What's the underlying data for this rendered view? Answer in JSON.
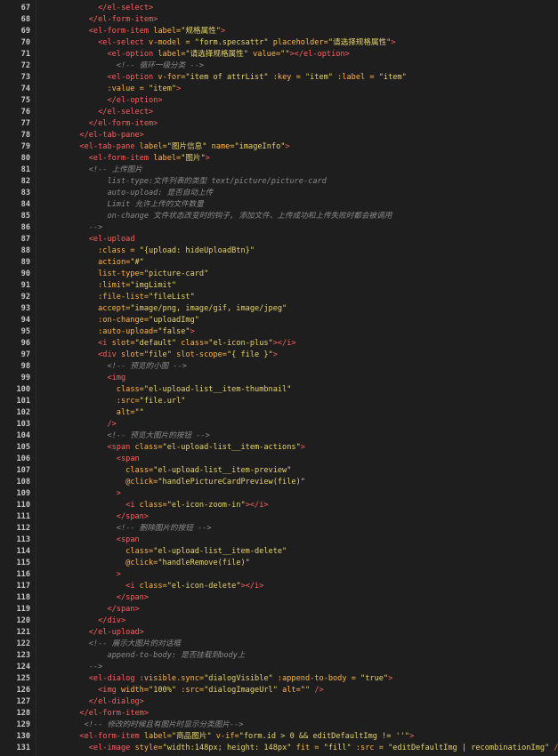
{
  "editor": {
    "lines": [
      {
        "n": "67",
        "t": [
          [
            "            ",
            "pun"
          ],
          [
            "</el-select>",
            "tag"
          ]
        ]
      },
      {
        "n": "68",
        "t": [
          [
            "          ",
            "pun"
          ],
          [
            "</el-form-item>",
            "tag"
          ]
        ]
      },
      {
        "n": "69",
        "t": [
          [
            "          ",
            "pun"
          ],
          [
            "<el-form-item ",
            "tag"
          ],
          [
            "label=",
            "att"
          ],
          [
            "\"规格属性\"",
            "str"
          ],
          [
            ">",
            "tag"
          ]
        ]
      },
      {
        "n": "70",
        "t": [
          [
            "            ",
            "pun"
          ],
          [
            "<el-select ",
            "tag"
          ],
          [
            "v-model = ",
            "att"
          ],
          [
            "\"form.specsattr\" ",
            "str"
          ],
          [
            "placeholder=",
            "att"
          ],
          [
            "\"请选择规格属性\"",
            "str"
          ],
          [
            ">",
            "tag"
          ]
        ]
      },
      {
        "n": "71",
        "t": [
          [
            "              ",
            "pun"
          ],
          [
            "<el-option ",
            "tag"
          ],
          [
            "label=",
            "att"
          ],
          [
            "\"请选择规格属性\" ",
            "str"
          ],
          [
            "value=",
            "att"
          ],
          [
            "\"\"",
            "str"
          ],
          [
            "></el-option>",
            "tag"
          ]
        ]
      },
      {
        "n": "72",
        "t": [
          [
            "                ",
            "pun"
          ],
          [
            "<!-- 循环一级分类 -->",
            "com"
          ]
        ]
      },
      {
        "n": "73",
        "t": [
          [
            "              ",
            "pun"
          ],
          [
            "<el-option ",
            "tag"
          ],
          [
            "v-for=",
            "att"
          ],
          [
            "\"item of attrList\" ",
            "str"
          ],
          [
            ":key = ",
            "att"
          ],
          [
            "\"item\" ",
            "str"
          ],
          [
            ":label = ",
            "att"
          ],
          [
            "\"item\"",
            "str"
          ]
        ]
      },
      {
        "n": "74",
        "t": [
          [
            "              ",
            "pun"
          ],
          [
            ":value = ",
            "att"
          ],
          [
            "\"item\"",
            "str"
          ],
          [
            ">",
            "tag"
          ]
        ]
      },
      {
        "n": "75",
        "t": [
          [
            "              ",
            "pun"
          ],
          [
            "</el-option>",
            "tag"
          ]
        ]
      },
      {
        "n": "76",
        "t": [
          [
            "            ",
            "pun"
          ],
          [
            "</el-select>",
            "tag"
          ]
        ]
      },
      {
        "n": "77",
        "t": [
          [
            "          ",
            "pun"
          ],
          [
            "</el-form-item>",
            "tag"
          ]
        ]
      },
      {
        "n": "78",
        "t": [
          [
            "        ",
            "pun"
          ],
          [
            "</el-tab-pane>",
            "tag"
          ]
        ]
      },
      {
        "n": "79",
        "t": [
          [
            "        ",
            "pun"
          ],
          [
            "<el-tab-pane ",
            "tag"
          ],
          [
            "label=",
            "att"
          ],
          [
            "\"图片信息\" ",
            "str"
          ],
          [
            "name=",
            "att"
          ],
          [
            "\"imageInfo\"",
            "str"
          ],
          [
            ">",
            "tag"
          ]
        ]
      },
      {
        "n": "80",
        "t": [
          [
            "          ",
            "pun"
          ],
          [
            "<el-form-item ",
            "tag"
          ],
          [
            "label=",
            "att"
          ],
          [
            "\"图片\"",
            "str"
          ],
          [
            ">",
            "tag"
          ]
        ]
      },
      {
        "n": "81",
        "t": [
          [
            "          ",
            "pun"
          ],
          [
            "<!-- 上传图片",
            "com"
          ]
        ]
      },
      {
        "n": "82",
        "t": [
          [
            "              ",
            "pun"
          ],
          [
            "list-type:文件列表的类型 text/picture/picture-card",
            "com"
          ]
        ]
      },
      {
        "n": "83",
        "t": [
          [
            "              ",
            "pun"
          ],
          [
            "auto-upload: 是否自动上传",
            "com"
          ]
        ]
      },
      {
        "n": "84",
        "t": [
          [
            "              ",
            "pun"
          ],
          [
            "Limit 允许上传的文件数量",
            "com"
          ]
        ]
      },
      {
        "n": "85",
        "t": [
          [
            "              ",
            "pun"
          ],
          [
            "on-change 文件状态改变时的钩子, 添加文件、上传成功和上传失败时都会被调用",
            "com"
          ]
        ]
      },
      {
        "n": "86",
        "t": [
          [
            "          ",
            "pun"
          ],
          [
            "-->",
            "com"
          ]
        ]
      },
      {
        "n": "87",
        "t": [
          [
            "          ",
            "pun"
          ],
          [
            "<el-upload",
            "tag"
          ]
        ]
      },
      {
        "n": "88",
        "t": [
          [
            "            ",
            "pun"
          ],
          [
            ":class = ",
            "att"
          ],
          [
            "\"{upload: hideUploadBtn}\"",
            "str"
          ]
        ]
      },
      {
        "n": "89",
        "t": [
          [
            "            ",
            "pun"
          ],
          [
            "action=",
            "att"
          ],
          [
            "\"#\"",
            "str"
          ]
        ]
      },
      {
        "n": "90",
        "t": [
          [
            "            ",
            "pun"
          ],
          [
            "list-type=",
            "att"
          ],
          [
            "\"picture-card\"",
            "str"
          ]
        ]
      },
      {
        "n": "91",
        "t": [
          [
            "            ",
            "pun"
          ],
          [
            ":limit=",
            "att"
          ],
          [
            "\"imgLimit\"",
            "str"
          ]
        ]
      },
      {
        "n": "92",
        "t": [
          [
            "            ",
            "pun"
          ],
          [
            ":file-list=",
            "att"
          ],
          [
            "\"fileList\"",
            "str"
          ]
        ]
      },
      {
        "n": "93",
        "t": [
          [
            "            ",
            "pun"
          ],
          [
            "accept=",
            "att"
          ],
          [
            "\"image/png, image/gif, image/jpeg\"",
            "str"
          ]
        ]
      },
      {
        "n": "94",
        "t": [
          [
            "            ",
            "pun"
          ],
          [
            ":on-change=",
            "att"
          ],
          [
            "\"uploadImg\"",
            "str"
          ]
        ]
      },
      {
        "n": "95",
        "t": [
          [
            "            ",
            "pun"
          ],
          [
            ":auto-upload=",
            "att"
          ],
          [
            "\"false\"",
            "str"
          ],
          [
            ">",
            "tag"
          ]
        ]
      },
      {
        "n": "96",
        "t": [
          [
            "            ",
            "pun"
          ],
          [
            "<i ",
            "tag"
          ],
          [
            "slot=",
            "att"
          ],
          [
            "\"default\" ",
            "str"
          ],
          [
            "class=",
            "att"
          ],
          [
            "\"el-icon-plus\"",
            "str"
          ],
          [
            "></i>",
            "tag"
          ]
        ]
      },
      {
        "n": "97",
        "t": [
          [
            "            ",
            "pun"
          ],
          [
            "<div ",
            "tag"
          ],
          [
            "slot=",
            "att"
          ],
          [
            "\"file\" ",
            "str"
          ],
          [
            "slot-scope=",
            "att"
          ],
          [
            "\"{ file }\"",
            "str"
          ],
          [
            ">",
            "tag"
          ]
        ]
      },
      {
        "n": "98",
        "t": [
          [
            "              ",
            "pun"
          ],
          [
            "<!-- 预览的小图 -->",
            "com"
          ]
        ]
      },
      {
        "n": "99",
        "t": [
          [
            "              ",
            "pun"
          ],
          [
            "<img",
            "tag"
          ]
        ]
      },
      {
        "n": "100",
        "t": [
          [
            "                ",
            "pun"
          ],
          [
            "class=",
            "att"
          ],
          [
            "\"el-upload-list__item-thumbnail\"",
            "str"
          ]
        ]
      },
      {
        "n": "101",
        "t": [
          [
            "                ",
            "pun"
          ],
          [
            ":src=",
            "att"
          ],
          [
            "\"file.url\"",
            "str"
          ]
        ]
      },
      {
        "n": "102",
        "t": [
          [
            "                ",
            "pun"
          ],
          [
            "alt=",
            "att"
          ],
          [
            "\"\"",
            "str"
          ]
        ]
      },
      {
        "n": "103",
        "t": [
          [
            "              ",
            "pun"
          ],
          [
            "/>",
            "tag"
          ]
        ]
      },
      {
        "n": "104",
        "t": [
          [
            "              ",
            "pun"
          ],
          [
            "<!-- 预览大图片的按钮 -->",
            "com"
          ]
        ]
      },
      {
        "n": "105",
        "t": [
          [
            "              ",
            "pun"
          ],
          [
            "<span ",
            "tag"
          ],
          [
            "class=",
            "att"
          ],
          [
            "\"el-upload-list__item-actions\"",
            "str"
          ],
          [
            ">",
            "tag"
          ]
        ]
      },
      {
        "n": "106",
        "t": [
          [
            "                ",
            "pun"
          ],
          [
            "<span",
            "tag"
          ]
        ]
      },
      {
        "n": "107",
        "t": [
          [
            "                  ",
            "pun"
          ],
          [
            "class=",
            "att"
          ],
          [
            "\"el-upload-list__item-preview\"",
            "str"
          ]
        ]
      },
      {
        "n": "108",
        "t": [
          [
            "                  ",
            "pun"
          ],
          [
            "@click=",
            "att"
          ],
          [
            "\"handlePictureCardPreview(file)\"",
            "str"
          ]
        ]
      },
      {
        "n": "109",
        "t": [
          [
            "                ",
            "pun"
          ],
          [
            ">",
            "tag"
          ]
        ]
      },
      {
        "n": "110",
        "t": [
          [
            "                  ",
            "pun"
          ],
          [
            "<i ",
            "tag"
          ],
          [
            "class=",
            "att"
          ],
          [
            "\"el-icon-zoom-in\"",
            "str"
          ],
          [
            "></i>",
            "tag"
          ]
        ]
      },
      {
        "n": "111",
        "t": [
          [
            "                ",
            "pun"
          ],
          [
            "</span>",
            "tag"
          ]
        ]
      },
      {
        "n": "112",
        "t": [
          [
            "                ",
            "pun"
          ],
          [
            "<!-- 删除图片的按钮 -->",
            "com"
          ]
        ]
      },
      {
        "n": "113",
        "t": [
          [
            "                ",
            "pun"
          ],
          [
            "<span",
            "tag"
          ]
        ]
      },
      {
        "n": "114",
        "t": [
          [
            "                  ",
            "pun"
          ],
          [
            "class=",
            "att"
          ],
          [
            "\"el-upload-list__item-delete\"",
            "str"
          ]
        ]
      },
      {
        "n": "115",
        "t": [
          [
            "                  ",
            "pun"
          ],
          [
            "@click=",
            "att"
          ],
          [
            "\"handleRemove(file)\"",
            "str"
          ]
        ]
      },
      {
        "n": "116",
        "t": [
          [
            "                ",
            "pun"
          ],
          [
            ">",
            "tag"
          ]
        ]
      },
      {
        "n": "117",
        "t": [
          [
            "                  ",
            "pun"
          ],
          [
            "<i ",
            "tag"
          ],
          [
            "class=",
            "att"
          ],
          [
            "\"el-icon-delete\"",
            "str"
          ],
          [
            "></i>",
            "tag"
          ]
        ]
      },
      {
        "n": "118",
        "t": [
          [
            "                ",
            "pun"
          ],
          [
            "</span>",
            "tag"
          ]
        ]
      },
      {
        "n": "119",
        "t": [
          [
            "              ",
            "pun"
          ],
          [
            "</span>",
            "tag"
          ]
        ]
      },
      {
        "n": "120",
        "t": [
          [
            "            ",
            "pun"
          ],
          [
            "</div>",
            "tag"
          ]
        ]
      },
      {
        "n": "121",
        "t": [
          [
            "          ",
            "pun"
          ],
          [
            "</el-upload>",
            "tag"
          ]
        ]
      },
      {
        "n": "122",
        "t": [
          [
            "          ",
            "pun"
          ],
          [
            "<!-- 展示大图片的对话框",
            "com"
          ]
        ]
      },
      {
        "n": "123",
        "t": [
          [
            "              ",
            "pun"
          ],
          [
            "append-to-body: 是否挂载到body上",
            "com"
          ]
        ]
      },
      {
        "n": "124",
        "t": [
          [
            "          ",
            "pun"
          ],
          [
            "-->",
            "com"
          ]
        ]
      },
      {
        "n": "125",
        "t": [
          [
            "          ",
            "pun"
          ],
          [
            "<el-dialog ",
            "tag"
          ],
          [
            ":visible.sync=",
            "att"
          ],
          [
            "\"dialogVisible\" ",
            "str"
          ],
          [
            ":append-to-body = ",
            "att"
          ],
          [
            "\"true\"",
            "str"
          ],
          [
            ">",
            "tag"
          ]
        ]
      },
      {
        "n": "126",
        "t": [
          [
            "            ",
            "pun"
          ],
          [
            "<img ",
            "tag"
          ],
          [
            "width=",
            "att"
          ],
          [
            "\"100%\" ",
            "str"
          ],
          [
            ":src=",
            "att"
          ],
          [
            "\"dialogImageUrl\" ",
            "str"
          ],
          [
            "alt=",
            "att"
          ],
          [
            "\"\" ",
            "str"
          ],
          [
            "/>",
            "tag"
          ]
        ]
      },
      {
        "n": "127",
        "t": [
          [
            "          ",
            "pun"
          ],
          [
            "</el-dialog>",
            "tag"
          ]
        ]
      },
      {
        "n": "128",
        "t": [
          [
            "        ",
            "pun"
          ],
          [
            "</el-form-item>",
            "tag"
          ]
        ]
      },
      {
        "n": "129",
        "t": [
          [
            "         ",
            "pun"
          ],
          [
            "<!-- 修改的时候且有图片时显示分类图片-->",
            "com"
          ]
        ]
      },
      {
        "n": "130",
        "t": [
          [
            "        ",
            "pun"
          ],
          [
            "<el-form-item ",
            "tag"
          ],
          [
            "label=",
            "att"
          ],
          [
            "\"商品图片\" ",
            "str"
          ],
          [
            "v-if=",
            "att"
          ],
          [
            "\"form.id > 0 && editDefaultImg != ''\"",
            "str"
          ],
          [
            ">",
            "tag"
          ]
        ]
      },
      {
        "n": "131",
        "t": [
          [
            "          ",
            "pun"
          ],
          [
            "<el-image ",
            "tag"
          ],
          [
            "style=",
            "att"
          ],
          [
            "\"width:148px; height: 148px\" ",
            "str"
          ],
          [
            "fit = ",
            "att"
          ],
          [
            "\"fill\" ",
            "str"
          ],
          [
            ":src = ",
            "att"
          ],
          [
            "\"editDefaultImg | recombinationImg\" ",
            "str"
          ],
          [
            "/>",
            "tag"
          ]
        ]
      }
    ]
  }
}
